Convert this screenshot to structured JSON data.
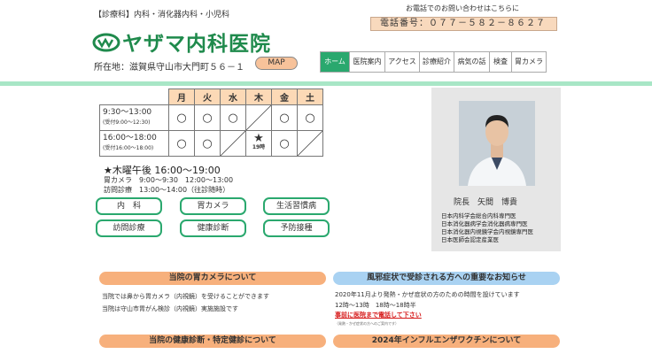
{
  "header": {
    "departments": "【診療科】内科・消化器内科・小児科",
    "logo_text": "ヤザマ内科医院",
    "address": "所在地：滋賀県守山市大門町５６－１",
    "map_label": "MAP",
    "contact_caption": "お電話でのお問い合わせはこちらに",
    "phone": "電話番号：０７７－５８２－８６２７"
  },
  "nav": [
    {
      "label": "ホーム",
      "active": true
    },
    {
      "label": "医院案内"
    },
    {
      "label": "アクセス"
    },
    {
      "label": "診療紹介"
    },
    {
      "label": "病気の話"
    },
    {
      "label": "検査"
    },
    {
      "label": "胃カメラ"
    }
  ],
  "schedule": {
    "days": [
      "月",
      "火",
      "水",
      "木",
      "金",
      "土"
    ],
    "rows": [
      {
        "time": "9:30～13:00",
        "sub": "(受付9:00～12:30)",
        "marks": [
          "○",
          "○",
          "○",
          "/",
          "○",
          "○"
        ]
      },
      {
        "time": "16:00～18:00",
        "sub": "(受付16:00～18:00)",
        "marks": [
          "○",
          "○",
          "/",
          "★",
          "○",
          "/"
        ],
        "star_note": "19時"
      }
    ],
    "note_main": "★木曜午後 16:00～19:00",
    "note_gastro": "胃カメラ　9:00～9:30　12:00～13:00",
    "note_visit": "訪問診療　13:00～14:00（往診随時）"
  },
  "services": [
    "内　科",
    "胃カメラ",
    "生活習慣病",
    "訪問診療",
    "健康診断",
    "予防接種"
  ],
  "doctor": {
    "title": "院長　矢間　博貴",
    "specialties": [
      "日本内科学会総合内科専門医",
      "日本消化器病学会消化器病専門医",
      "日本消化器内視鏡学会内視鏡専門医",
      "日本医師会認定産業医"
    ]
  },
  "sections": {
    "gastro_head": "当院の胃カメラについて",
    "gastro_lines": [
      "当院では鼻から胃カメラ（内視鏡）を受けることができます",
      "当院は守山市胃がん検診（内視鏡）実施施設です"
    ],
    "cold_head": "風邪症状で受診される方への重要なお知らせ",
    "cold_lines": [
      "2020年11月より発熱・かぜ症状の方のための時間を設けています",
      "12時～13時　18時～18時半"
    ],
    "cold_link": "事前に医院まで電話して下さい",
    "cold_small": "（発熱・かぜ症状の方へのご案内です）",
    "checkup_head": "当院の健康診断・特定健診について",
    "flu_head": "2024年インフルエンザワクチンについて"
  },
  "colors": {
    "accent_green": "#2aa86e",
    "peach": "#f8d9bd",
    "section_orange": "#f7b07c",
    "section_blue": "#a9d2f2"
  }
}
